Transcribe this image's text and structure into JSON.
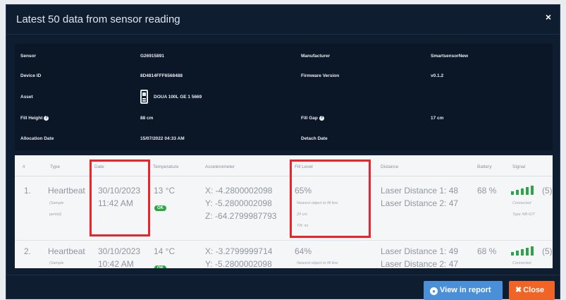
{
  "modal": {
    "title": "Latest 50 data from sensor reading",
    "close_icon": "×"
  },
  "info": {
    "sensor_label": "Sensor",
    "sensor_value": "G26915891",
    "manufacturer_label": "Manufacturer",
    "manufacturer_value": "SmartsensorNew",
    "device_id_label": "Device ID",
    "device_id_value": "8D4814FFF6568488",
    "firmware_label": "Firmware Version",
    "firmware_value": "v0.1.2",
    "asset_label": "Asset",
    "asset_value": "DOUA 100L GE 1 5669",
    "fill_height_label": "Fill Height",
    "fill_height_value": "88 cm",
    "fill_gap_label": "Fill Gap",
    "fill_gap_value": "17 cm",
    "allocation_label": "Allocation Date",
    "allocation_value": "15/07/2022 04:33 AM",
    "detach_label": "Detach Date",
    "detach_value": ""
  },
  "table": {
    "headers": [
      "#",
      "Type",
      "Date",
      "Temperature",
      "Accelerometer",
      "Fill Level",
      "Distance",
      "Battery",
      "Signal"
    ],
    "rows": [
      {
        "num": "1.",
        "type": "Heartbeat",
        "type_sub1": "(Sample",
        "type_sub2": "period)",
        "date": "30/10/2023",
        "time": "11:42 AM",
        "temp": "13 °C",
        "status": "OK",
        "acc_x": "X: -4.2800002098",
        "acc_y": "Y: -5.2800002098",
        "acc_z": "Z: -64.2799987793",
        "fill": "65%",
        "fill_note1": "Nearest object to fill line",
        "fill_note2": "20 cm",
        "fill_note3": "Tilt: no",
        "dist1": "Laser Distance 1: 48",
        "dist2": "Laser Distance 2: 47",
        "battery": "68 %",
        "signal_val": "(5)",
        "signal_note1": "Connected",
        "signal_note2": "Type NB-IOT",
        "signal_level": 5
      },
      {
        "num": "2.",
        "type": "Heartbeat",
        "type_sub1": "(Sample",
        "date": "30/10/2023",
        "time": "10:42 AM",
        "temp": "14 °C",
        "status": "OK",
        "acc_x": "X: -3.2799999714",
        "acc_y": "Y: -5.2800002098",
        "fill": "64%",
        "fill_note1": "Nearest object to fill line",
        "dist1": "Laser Distance 1: 49",
        "dist2": "Laser Distance 2: 47",
        "battery": "68 %",
        "signal_val": "(5)",
        "signal_note1": "Connected",
        "signal_level": 5
      }
    ]
  },
  "footer": {
    "report_label": "View in report",
    "report_icon": "eye-icon",
    "close_label": "Close",
    "close_icon": "x-icon"
  },
  "colors": {
    "modal_bg": "#0f1d31",
    "highlight": "#e8252b",
    "report_btn": "#4a90d9",
    "close_btn": "#f06425",
    "ok_badge": "#26a842"
  }
}
